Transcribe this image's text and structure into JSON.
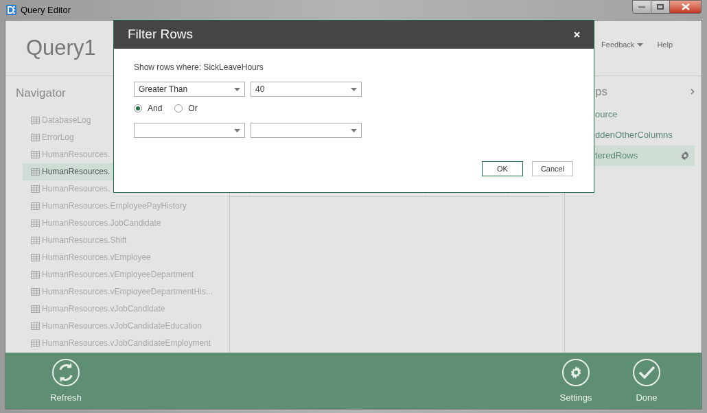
{
  "window": {
    "title": "Query Editor"
  },
  "header": {
    "query_name": "Query1",
    "menu": [
      {
        "label": "Feedback",
        "kind": "dropdown"
      },
      {
        "label": "Help",
        "kind": "link"
      }
    ]
  },
  "navigator": {
    "title": "Navigator",
    "items": [
      {
        "label": "DatabaseLog",
        "selected": false
      },
      {
        "label": "ErrorLog",
        "selected": false
      },
      {
        "label": "HumanResources.",
        "selected": false
      },
      {
        "label": "HumanResources.",
        "selected": true
      },
      {
        "label": "HumanResources.",
        "selected": false
      },
      {
        "label": "HumanResources.EmployeePayHistory",
        "selected": false
      },
      {
        "label": "HumanResources.JobCandidate",
        "selected": false
      },
      {
        "label": "HumanResources.Shift",
        "selected": false
      },
      {
        "label": "HumanResources.vEmployee",
        "selected": false
      },
      {
        "label": "HumanResources.vEmployeeDepartment",
        "selected": false
      },
      {
        "label": "HumanResources.vEmployeeDepartmentHis...",
        "selected": false
      },
      {
        "label": "HumanResources.vJobCandidate",
        "selected": false
      },
      {
        "label": "HumanResources.vJobCandidateEducation",
        "selected": false
      },
      {
        "label": "HumanResources.vJobCandidateEmployment",
        "selected": false
      }
    ]
  },
  "steps": {
    "title": "ps",
    "items": [
      {
        "label": "ource",
        "selected": false
      },
      {
        "label": "ddenOtherColumns",
        "selected": false
      },
      {
        "label": "teredRows",
        "selected": true
      }
    ]
  },
  "dialog": {
    "title": "Filter Rows",
    "prompt": "Show rows where: SickLeaveHours",
    "conditions": [
      {
        "kind": "filled",
        "operator": "Greater Than",
        "value": "40"
      },
      {
        "kind": "empty"
      }
    ],
    "logic": [
      {
        "label": "And",
        "selected": true
      },
      {
        "label": "Or",
        "selected": false
      }
    ],
    "buttons": [
      {
        "label": "OK",
        "kind": "primary"
      },
      {
        "label": "Cancel",
        "kind": "secondary"
      }
    ]
  },
  "footer": {
    "left": [
      {
        "label": "Refresh",
        "kind": "refresh"
      }
    ],
    "right": [
      {
        "label": "Settings",
        "kind": "settings"
      },
      {
        "label": "Done",
        "kind": "done"
      }
    ]
  }
}
